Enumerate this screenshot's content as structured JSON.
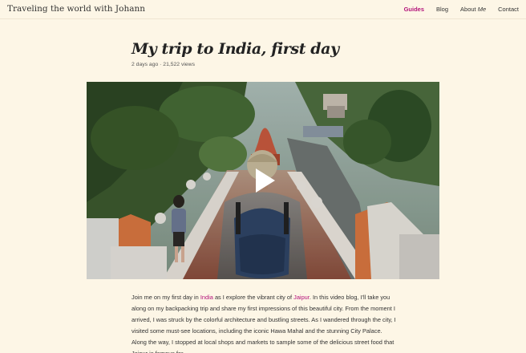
{
  "site": {
    "title": "Traveling the world with Johann"
  },
  "nav": {
    "items": [
      {
        "label": "Guides"
      },
      {
        "label": "Blog"
      },
      {
        "label_a": "About ",
        "label_b": "Me"
      },
      {
        "label": "Contact"
      }
    ],
    "active_color": "#b3127a"
  },
  "post": {
    "title": "My trip to India, first day",
    "meta": "2 days ago · 21,522 views",
    "video": {
      "play_icon": "play-icon"
    },
    "body": {
      "p1": "Join me on my first day in ",
      "link1": "India",
      "p2": " as I explore the vibrant city of ",
      "link2": "Jaipur",
      "p3": ". In this video blog, I'll take you along on my backpacking trip and share my first impressions of this beautiful city. From the moment I arrived, I was struck by the colorful architecture and bustling streets. As I wandered through the city, I visited some must-see locations, including the iconic Hawa Mahal and the stunning City Palace. Along the way, I stopped at local shops and markets to sample some of the delicious street food that Jaipur is famous for."
    }
  },
  "colors": {
    "background": "#fdf6e6",
    "link": "#b3127a"
  }
}
